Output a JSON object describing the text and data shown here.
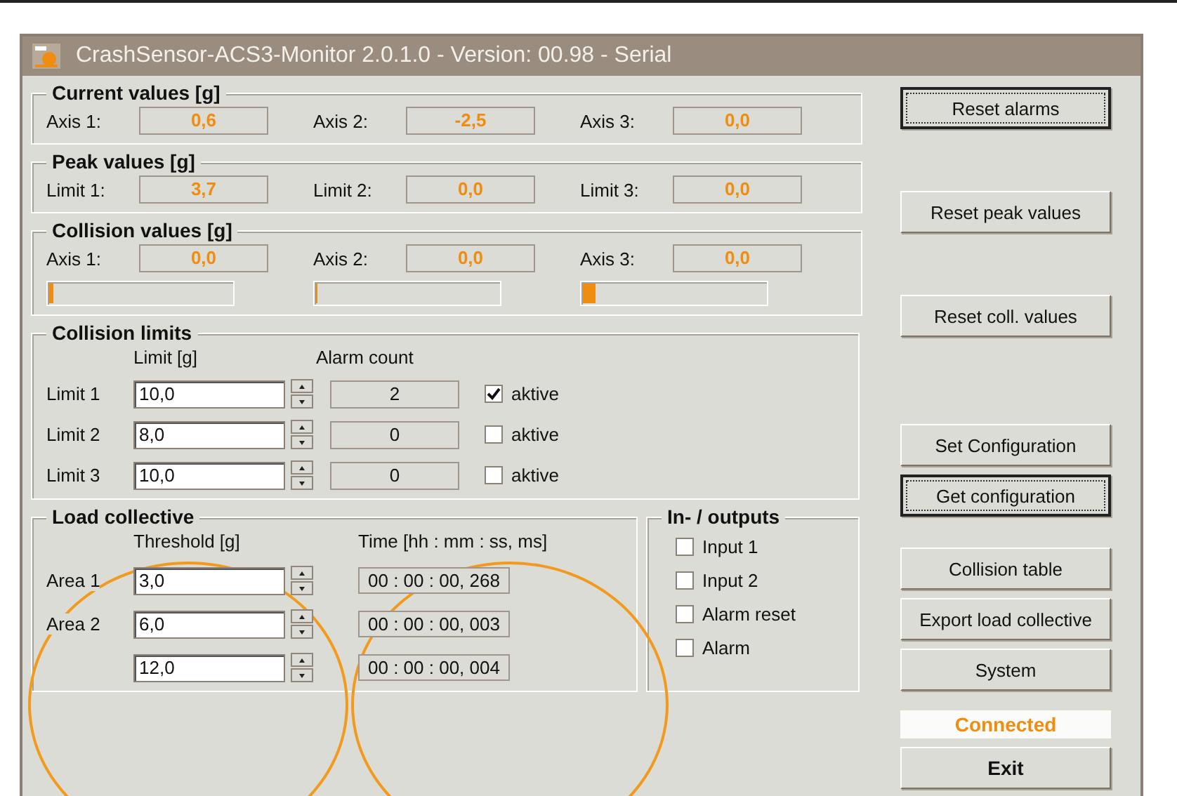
{
  "window": {
    "title": "CrashSensor-ACS3-Monitor   2.0.1.0 - Version: 00.98 - Serial"
  },
  "current_values": {
    "title": "Current values [g]",
    "items": [
      {
        "label": "Axis 1:",
        "value": "0,6"
      },
      {
        "label": "Axis 2:",
        "value": "-2,5"
      },
      {
        "label": "Axis 3:",
        "value": "0,0"
      }
    ]
  },
  "peak_values": {
    "title": "Peak values [g]",
    "items": [
      {
        "label": "Limit 1:",
        "value": "3,7"
      },
      {
        "label": "Limit 2:",
        "value": "0,0"
      },
      {
        "label": "Limit 3:",
        "value": "0,0"
      }
    ]
  },
  "collision_values": {
    "title": "Collision values [g]",
    "items": [
      {
        "label": "Axis 1:",
        "value": "0,0",
        "level": 0.02
      },
      {
        "label": "Axis 2:",
        "value": "0,0",
        "level": 0
      },
      {
        "label": "Axis 3:",
        "value": "0,0",
        "level": 0.07
      }
    ]
  },
  "collision_limits": {
    "title": "Collision limits",
    "limit_header": "Limit [g]",
    "count_header": "Alarm count",
    "rows": [
      {
        "label": "Limit 1",
        "value": "10,0",
        "count": "2",
        "check_label": "aktive",
        "checked": true
      },
      {
        "label": "Limit 2",
        "value": "8,0",
        "count": "0",
        "check_label": "aktive",
        "checked": false
      },
      {
        "label": "Limit 3",
        "value": "10,0",
        "count": "0",
        "check_label": "aktive",
        "checked": false
      }
    ]
  },
  "load_collective": {
    "title": "Load collective",
    "threshold_header": "Threshold [g]",
    "time_header": "Time [hh : mm : ss, ms]",
    "rows": [
      {
        "label": "Area 1",
        "value": "3,0",
        "time": "00 : 00 : 00, 268"
      },
      {
        "label": "Area 2",
        "value": "6,0",
        "time": "00 : 00 : 00, 003"
      },
      {
        "value": "12,0",
        "time": "00 : 00 : 00, 004"
      }
    ]
  },
  "io": {
    "title": "In- / outputs",
    "items": [
      {
        "label": "Input 1",
        "checked": false
      },
      {
        "label": "Input 2",
        "checked": false
      },
      {
        "label": "Alarm reset",
        "checked": false
      },
      {
        "label": "Alarm",
        "checked": false
      }
    ]
  },
  "buttons": [
    {
      "kind": "button",
      "label": "Reset alarms",
      "focused": true
    },
    {
      "kind": "button",
      "label": "Reset peak values",
      "focused": false
    },
    {
      "kind": "button",
      "label": "Reset coll. values",
      "focused": false
    },
    {
      "kind": "button",
      "label": "Set Configuration",
      "focused": false
    },
    {
      "kind": "button",
      "label": "Get configuration",
      "focused": true
    },
    {
      "kind": "button",
      "label": "Collision table",
      "focused": false
    },
    {
      "kind": "button",
      "label": "Export load collective",
      "focused": false
    },
    {
      "kind": "button",
      "label": "System",
      "focused": false
    },
    {
      "kind": "status",
      "label": "Connected"
    },
    {
      "kind": "button",
      "label": "Exit",
      "focused": false,
      "bold": true
    }
  ]
}
